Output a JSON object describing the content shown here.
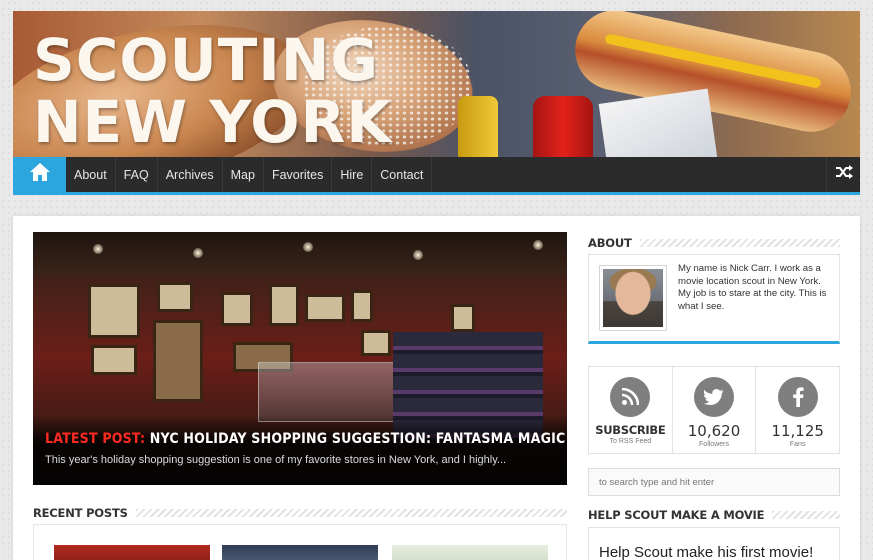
{
  "header": {
    "logo_line1": "SCOUTING",
    "logo_line2": "NEW YORK"
  },
  "nav": {
    "home_icon": "home-icon",
    "items": [
      "About",
      "FAQ",
      "Archives",
      "Map",
      "Favorites",
      "Hire",
      "Contact"
    ],
    "shuffle_icon": "shuffle-icon",
    "accent_color": "#2da6df"
  },
  "featured": {
    "tag": "LATEST POST:",
    "title": "NYC HOLIDAY SHOPPING SUGGESTION: FANTASMA MAGIC",
    "excerpt": "This year's holiday shopping suggestion is one of my favorite stores in New York, and I highly..."
  },
  "recent": {
    "heading": "RECENT POSTS"
  },
  "about": {
    "heading": "ABOUT",
    "text": "My name is Nick Carr. I work as a movie location scout in New York. My job is to stare at the city. This is what I see."
  },
  "social": {
    "rss": {
      "icon": "rss-icon",
      "title": "SUBSCRIBE",
      "label": "To RSS Feed"
    },
    "twitter": {
      "icon": "twitter-icon",
      "count": "10,620",
      "label": "Followers"
    },
    "facebook": {
      "icon": "facebook-icon",
      "count": "11,125",
      "label": "Fans"
    }
  },
  "search": {
    "placeholder": "to search type and hit enter"
  },
  "help": {
    "heading": "HELP SCOUT MAKE A MOVIE",
    "text": "Help Scout make his first movie!"
  }
}
